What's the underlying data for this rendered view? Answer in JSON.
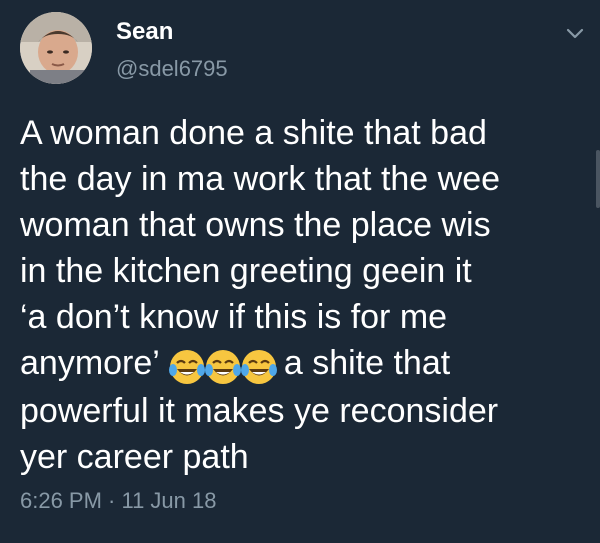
{
  "user": {
    "display_name": "Sean",
    "handle": "@sdel6795"
  },
  "tweet": {
    "lines": [
      "A woman done a shite that bad",
      "the day in ma work that the wee",
      "woman that owns the place wis",
      "in the kitchen greeting geein it",
      "‘a don’t know if this is for me",
      "anymore’",
      "a shite that",
      "powerful it makes ye reconsider",
      "yer career path"
    ],
    "emojis": [
      "tears-of-joy-emoji",
      "tears-of-joy-emoji",
      "tears-of-joy-emoji"
    ],
    "timestamp": "6:26 PM · 11 Jun 18"
  },
  "icons": {
    "menu": "chevron-down-icon"
  },
  "colors": {
    "background": "#1b2836",
    "text": "#ffffff",
    "secondary_text": "#8899a6"
  }
}
